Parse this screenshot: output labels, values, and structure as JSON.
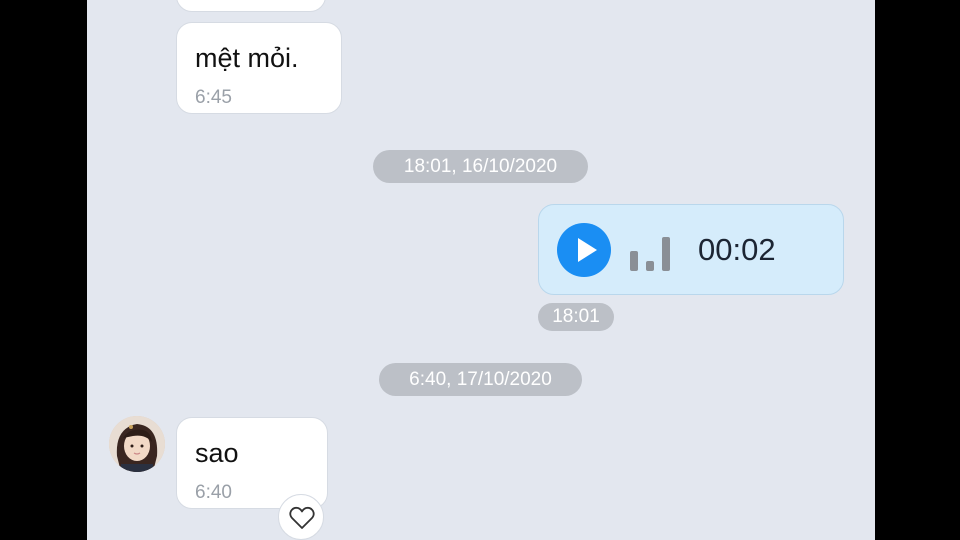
{
  "messages": [
    {
      "text": "mệt mỏi.",
      "time": "6:45",
      "direction": "incoming"
    },
    {
      "type": "voice",
      "duration": "00:02",
      "time": "18:01",
      "direction": "outgoing"
    },
    {
      "text": "sao",
      "time": "6:40",
      "direction": "incoming",
      "reaction_icon": "heart-outline-icon"
    }
  ],
  "date_separators": [
    "18:01, 16/10/2020",
    "6:40, 17/10/2020"
  ],
  "colors": {
    "chat_background": "#e3e7ef",
    "incoming_bubble": "#ffffff",
    "outgoing_bubble": "#d5ecfb",
    "accent": "#1a8ef3",
    "pill": "#bcc0c7"
  }
}
